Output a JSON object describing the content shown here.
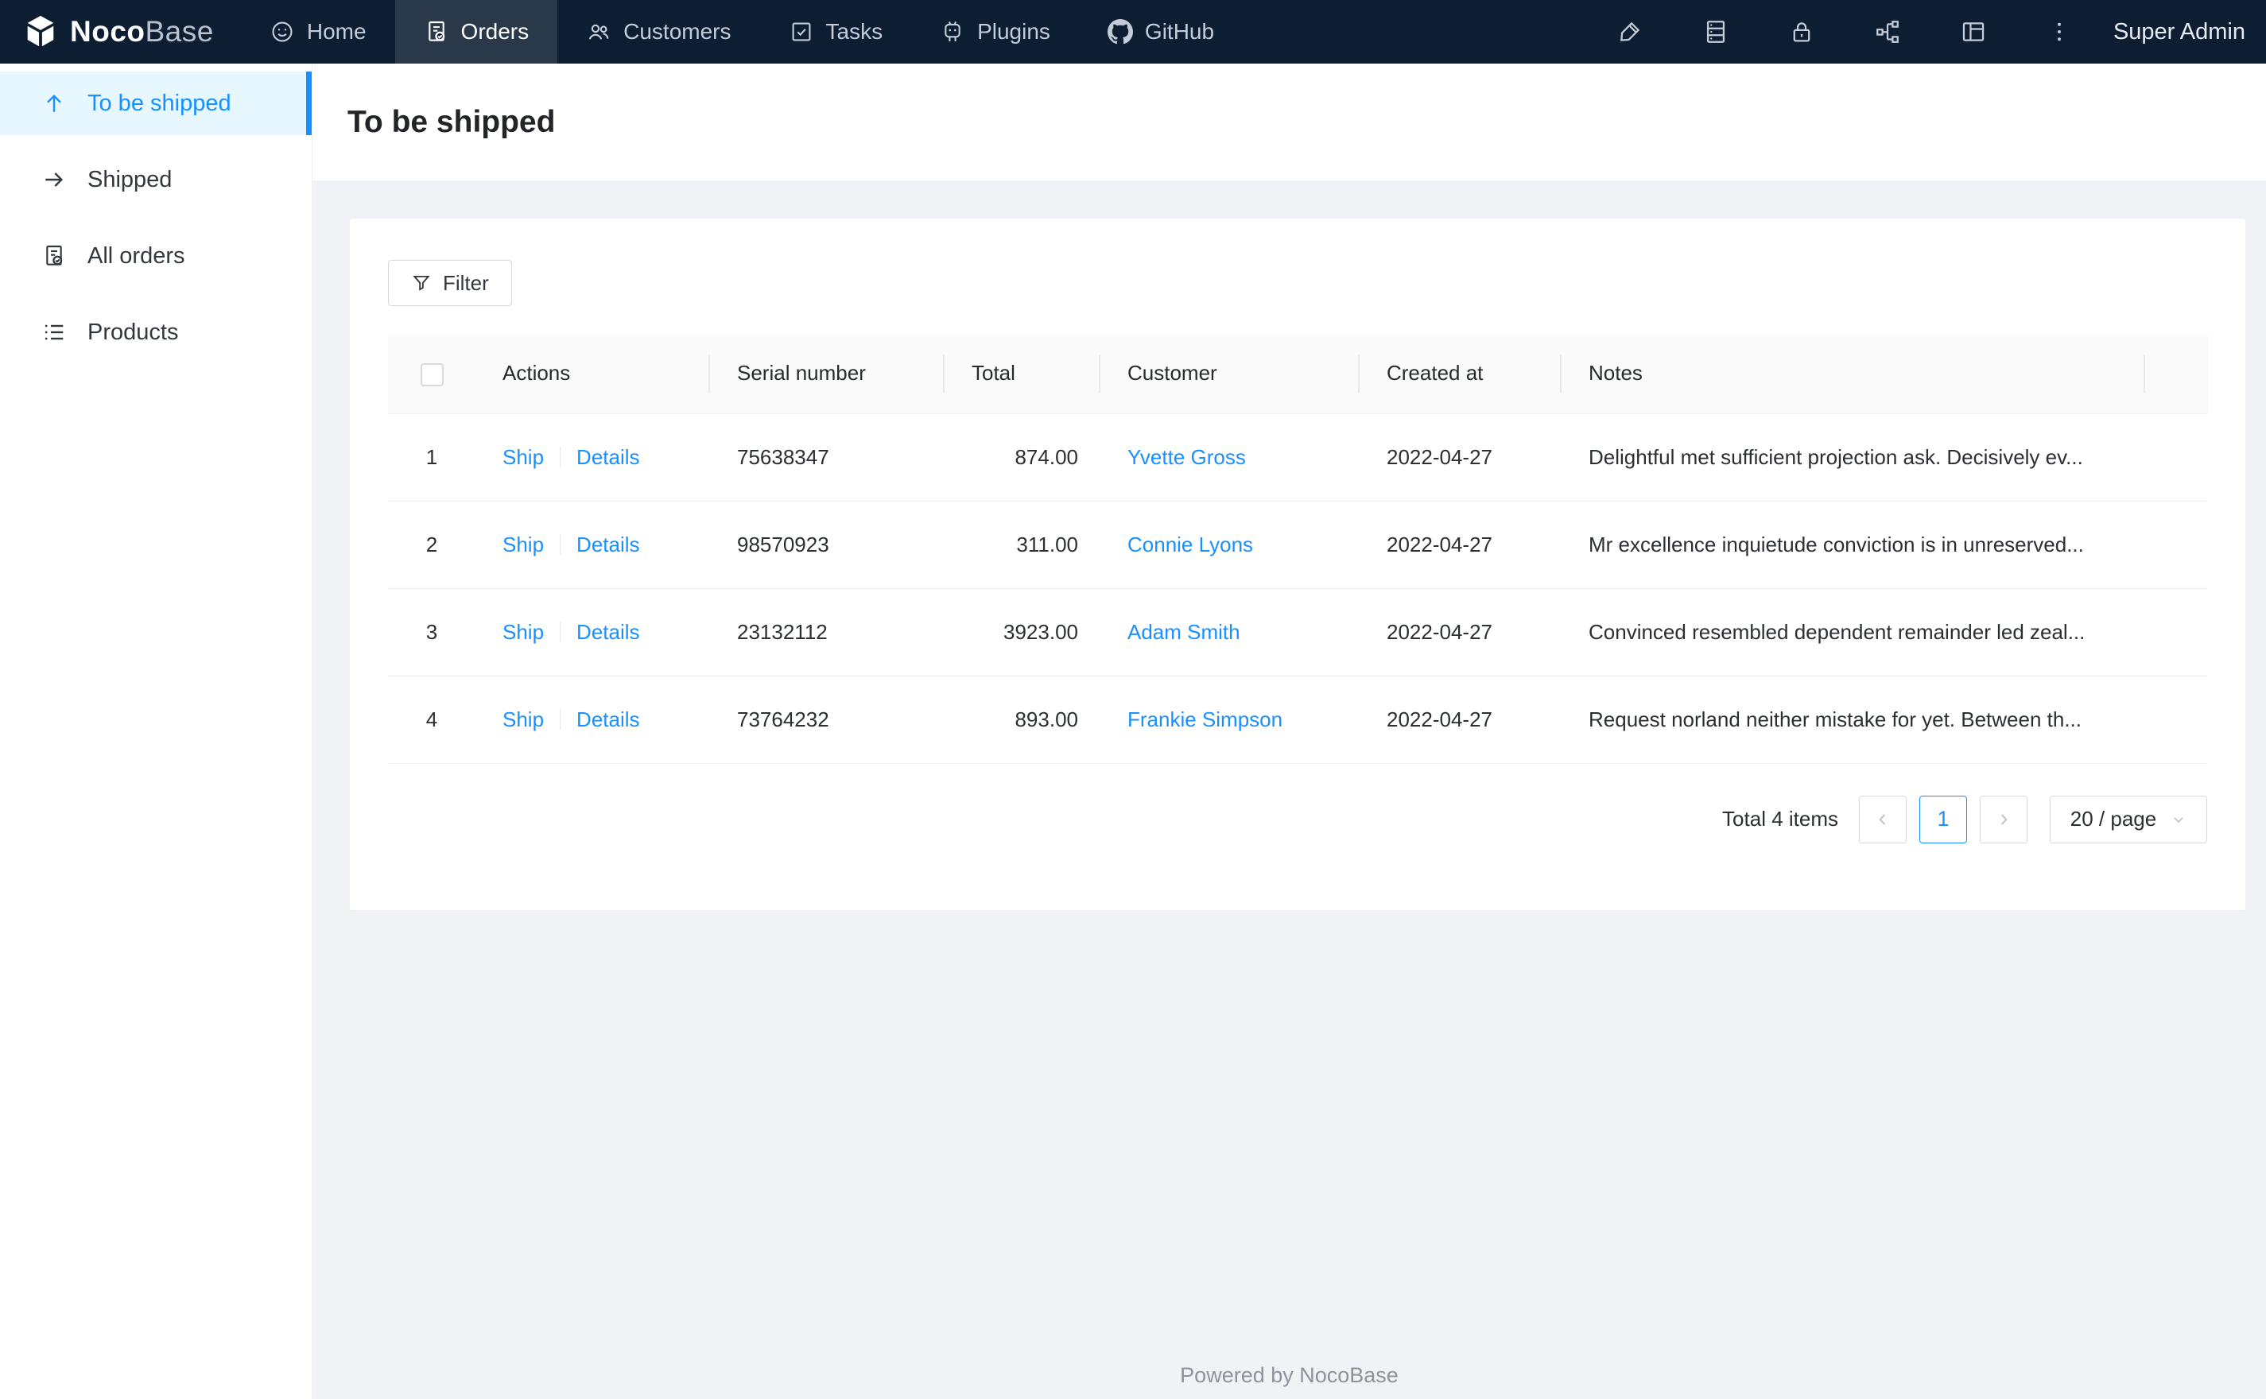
{
  "brand": {
    "name_bold": "Noco",
    "name_light": "Base"
  },
  "colors": {
    "topbar_bg": "#0d1e32",
    "accent": "#1890ff",
    "sidebar_active_bg": "#e6f7ff",
    "content_bg": "#f0f2f5",
    "table_header_bg": "#fafafa",
    "border": "#f0f0f0"
  },
  "nav": {
    "items": [
      {
        "label": "Home",
        "icon": "smile-icon"
      },
      {
        "label": "Orders",
        "icon": "file-done-icon"
      },
      {
        "label": "Customers",
        "icon": "team-icon"
      },
      {
        "label": "Tasks",
        "icon": "check-square-icon"
      },
      {
        "label": "Plugins",
        "icon": "robot-icon"
      },
      {
        "label": "GitHub",
        "icon": "github-icon"
      }
    ],
    "active_item": "Orders",
    "user": "Super Admin"
  },
  "sidebar": {
    "items": [
      {
        "label": "To be shipped",
        "icon": "arrow-up-icon",
        "active": true
      },
      {
        "label": "Shipped",
        "icon": "arrow-right-icon",
        "active": false
      },
      {
        "label": "All orders",
        "icon": "file-done-icon",
        "active": false
      },
      {
        "label": "Products",
        "icon": "list-icon",
        "active": false
      }
    ]
  },
  "page": {
    "title": "To be shipped"
  },
  "toolbar": {
    "filter_label": "Filter"
  },
  "table": {
    "columns": [
      "Actions",
      "Serial number",
      "Total",
      "Customer",
      "Created at",
      "Notes"
    ],
    "rows": [
      {
        "index": "1",
        "ship": "Ship",
        "details": "Details",
        "serial": "75638347",
        "total": "874.00",
        "customer": "Yvette Gross",
        "created_at": "2022-04-27",
        "notes": "Delightful met sufficient projection ask. Decisively ev..."
      },
      {
        "index": "2",
        "ship": "Ship",
        "details": "Details",
        "serial": "98570923",
        "total": "311.00",
        "customer": "Connie Lyons",
        "created_at": "2022-04-27",
        "notes": "Mr excellence inquietude conviction is in unreserved..."
      },
      {
        "index": "3",
        "ship": "Ship",
        "details": "Details",
        "serial": "23132112",
        "total": "3923.00",
        "customer": "Adam Smith",
        "created_at": "2022-04-27",
        "notes": "Convinced resembled dependent remainder led zeal..."
      },
      {
        "index": "4",
        "ship": "Ship",
        "details": "Details",
        "serial": "73764232",
        "total": "893.00",
        "customer": "Frankie Simpson",
        "created_at": "2022-04-27",
        "notes": "Request norland neither mistake for yet. Between th..."
      }
    ]
  },
  "pagination": {
    "total_label": "Total 4 items",
    "current_page": "1",
    "page_size": "20 / page"
  },
  "footer": {
    "text": "Powered by NocoBase"
  }
}
